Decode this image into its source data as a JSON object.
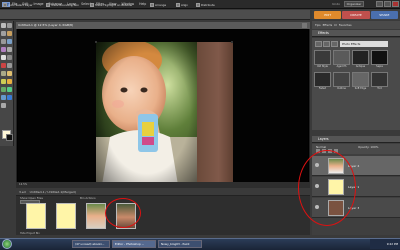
{
  "app": {
    "menu": [
      "File",
      "Edit",
      "Image",
      "Enhance",
      "Layer",
      "Select",
      "Filter",
      "View",
      "Window",
      "Help"
    ],
    "undo_label": "Undo",
    "organizer_label": "Organizer"
  },
  "options": {
    "auto_select": "Auto Select Layer",
    "bounding": "Show Bounding Box",
    "highlight": "Show Highlight on Rollover",
    "arrange": "Arrange",
    "align": "Align",
    "distribute": "Distribute"
  },
  "modes": [
    {
      "label": "EDIT",
      "color": "#e08a2c"
    },
    {
      "label": "CREATE",
      "color": "#c0504d"
    },
    {
      "label": "SHARE",
      "color": "#4a6fae"
    }
  ],
  "document": {
    "title": "Untitled-1 @ 12.5% (Layer 4, RGB/8)",
    "status": "12.5%",
    "tabs": [
      "3.ed",
      "Untitled-1 / Untitled-1(Merged)"
    ]
  },
  "bin": {
    "show_label": "Show Open Files",
    "actions_label": "Bin Actions",
    "hide_label": "Hide Project Bin"
  },
  "panels": {
    "effects_title": "Effects",
    "effects_dropdown": "Photo Effects",
    "effects": [
      "Old Style",
      "Aged Ph",
      "Antique",
      "Sepia",
      "Faded",
      "Outline",
      "Soft Edge",
      "Tint"
    ],
    "quick_buttons": [
      "Tips",
      "Effects",
      "Cl",
      "Favorites"
    ],
    "layers_title": "Layers",
    "mode_label": "Normal",
    "opacity_label": "Opacity: 100%",
    "layers": [
      "Layer 4",
      "Layer 1",
      "Layer 3"
    ]
  },
  "taskbar": {
    "items": [
      "(47 unread) ebooki...",
      "Editor - Photoshop ...",
      "Nowy_blog03 - Paint"
    ],
    "time": "9:22 PM"
  },
  "colors": {
    "circle": "#dd1111",
    "accent_edit": "#e08a2c"
  }
}
